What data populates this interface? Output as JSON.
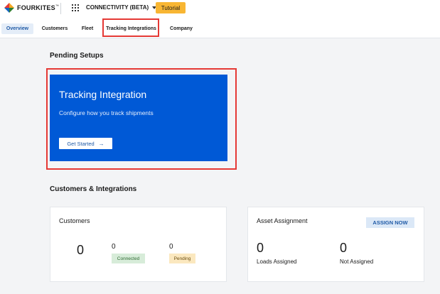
{
  "header": {
    "logo_text": "FOURKITES",
    "logo_tm": "™",
    "product_label": "CONNECTIVITY (BETA)",
    "tutorial_label": "Tutorial",
    "icons": {
      "logo": "fourkites-logo-icon",
      "apps": "apps-grid-icon",
      "caret": "chevron-down-icon"
    }
  },
  "nav": {
    "tabs": [
      {
        "label": "Overview",
        "active": true
      },
      {
        "label": "Customers"
      },
      {
        "label": "Fleet"
      },
      {
        "label": "Tracking Integrations",
        "highlighted": true
      },
      {
        "label": "Company"
      }
    ]
  },
  "pending": {
    "section_title": "Pending Setups",
    "card": {
      "title": "Tracking Integration",
      "description": "Configure how you track shipments",
      "button_label": "Get Started",
      "button_icon": "arrow-right-icon"
    }
  },
  "integrations": {
    "section_title": "Customers & Integrations",
    "customers": {
      "heading": "Customers",
      "total": "0",
      "connected_count": "0",
      "connected_label": "Connected",
      "pending_count": "0",
      "pending_label": "Pending"
    },
    "assets": {
      "heading": "Asset Assignment",
      "assign_label": "ASSIGN NOW",
      "loads_assigned_count": "0",
      "loads_assigned_label": "Loads Assigned",
      "not_assigned_count": "0",
      "not_assigned_label": "Not Assigned"
    }
  },
  "colors": {
    "accent_blue": "#0059d6",
    "highlight_red": "#e53935",
    "tutorial_yellow": "#f8b633",
    "connected_green": "#d7ecd9",
    "pending_yellow": "#fbe8bf"
  }
}
